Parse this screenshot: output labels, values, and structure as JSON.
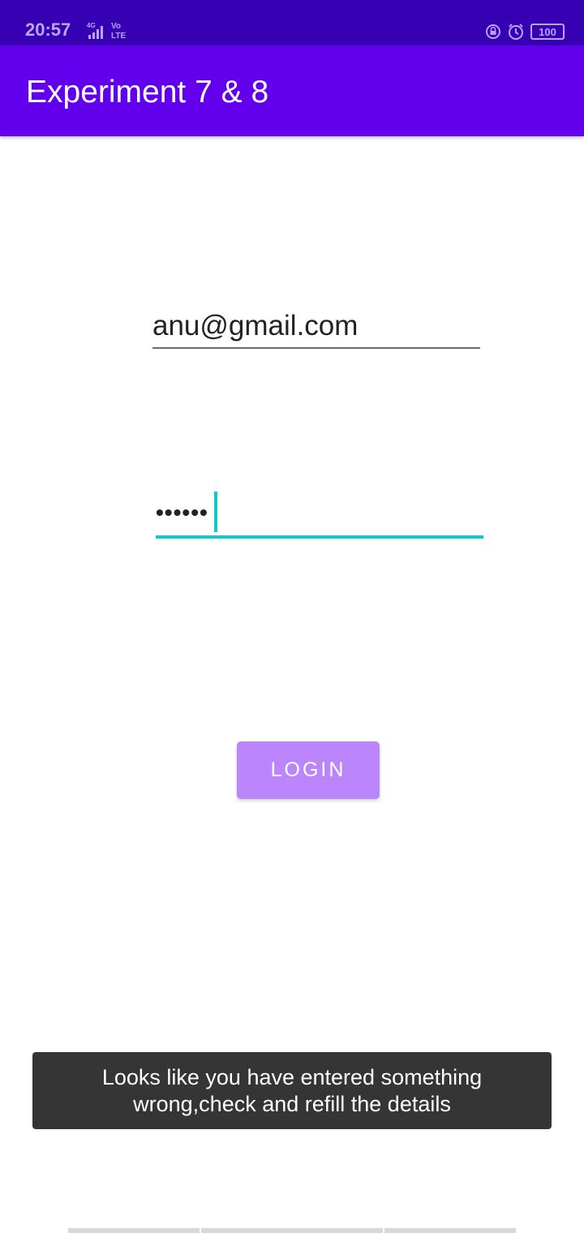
{
  "status_bar": {
    "time": "20:57",
    "network": "4G",
    "volte": "Vo LTE",
    "battery": "100"
  },
  "app_bar": {
    "title": "Experiment 7 & 8"
  },
  "form": {
    "email_value": "anu@gmail.com",
    "password_value": "••••••",
    "login_label": "LOGIN"
  },
  "toast": {
    "message": "Looks like you have entered something wrong,check and refill the details"
  },
  "colors": {
    "status_bar": "#3700b3",
    "app_bar": "#6200ee",
    "accent": "#18c7c3",
    "login_button": "#bb86fc"
  }
}
